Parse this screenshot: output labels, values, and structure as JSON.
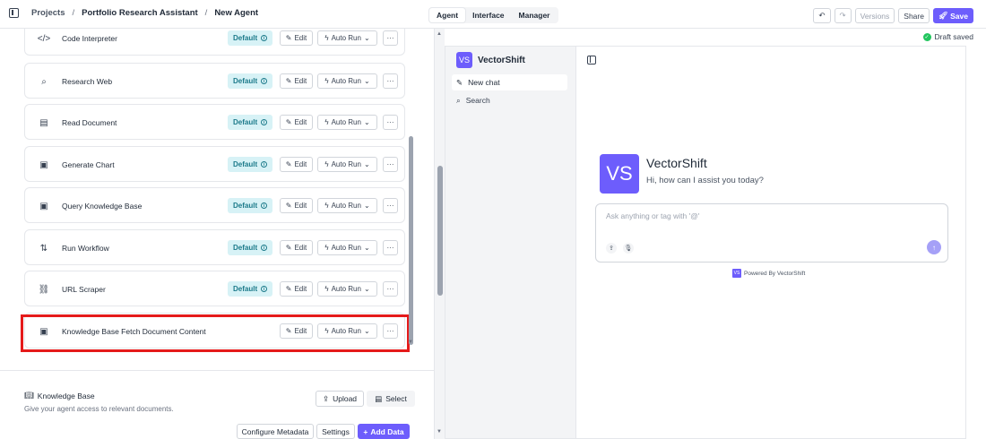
{
  "breadcrumb": {
    "project": "Projects",
    "assistant": "Portfolio Research Assistant",
    "current": "New Agent"
  },
  "mode_tabs": [
    "Agent",
    "Interface",
    "Manager"
  ],
  "toolbar": {
    "undo": "↶",
    "redo": "↷",
    "versions": "Versions",
    "share": "Share",
    "save": "Save",
    "draft_status": "Draft saved"
  },
  "tools": [
    {
      "name": "Code Interpreter",
      "icon": "code-icon",
      "glyph": "</>",
      "default": "Default"
    },
    {
      "name": "Research Web",
      "icon": "search-icon",
      "glyph": "⌕",
      "default": "Default"
    },
    {
      "name": "Read Document",
      "icon": "document-icon",
      "glyph": "▤",
      "default": "Default"
    },
    {
      "name": "Generate Chart",
      "icon": "chart-icon",
      "glyph": "▣",
      "default": "Default"
    },
    {
      "name": "Query Knowledge Base",
      "icon": "database-icon",
      "glyph": "▣",
      "default": "Default"
    },
    {
      "name": "Run Workflow",
      "icon": "workflow-icon",
      "glyph": "⇅",
      "default": "Default"
    },
    {
      "name": "URL Scraper",
      "icon": "link-icon",
      "glyph": "⛓",
      "default": "Default"
    },
    {
      "name": "Knowledge Base Fetch Document Content",
      "icon": "database-icon",
      "glyph": "▣",
      "default": ""
    }
  ],
  "tool_actions": {
    "edit": "Edit",
    "auto_run": "Auto Run",
    "more": "···"
  },
  "knowledge_base": {
    "title": "Knowledge Base",
    "description": "Give your agent access to relevant documents.",
    "upload": "Upload",
    "select": "Select",
    "configure_metadata": "Configure Metadata",
    "settings": "Settings",
    "add_data": "Add Data"
  },
  "preview": {
    "brand": "VectorShift",
    "logo_text": "VS",
    "new_chat": "New chat",
    "search": "Search",
    "hero_name": "VectorShift",
    "hero_greeting": "Hi, how can I assist you today?",
    "input_placeholder": "Ask anything or tag with '@'",
    "powered_by": "Powered By VectorShift"
  },
  "colors": {
    "accent": "#6d5dfc",
    "default_badge_bg": "#d7f2f6",
    "highlight": "#e51a1a"
  }
}
